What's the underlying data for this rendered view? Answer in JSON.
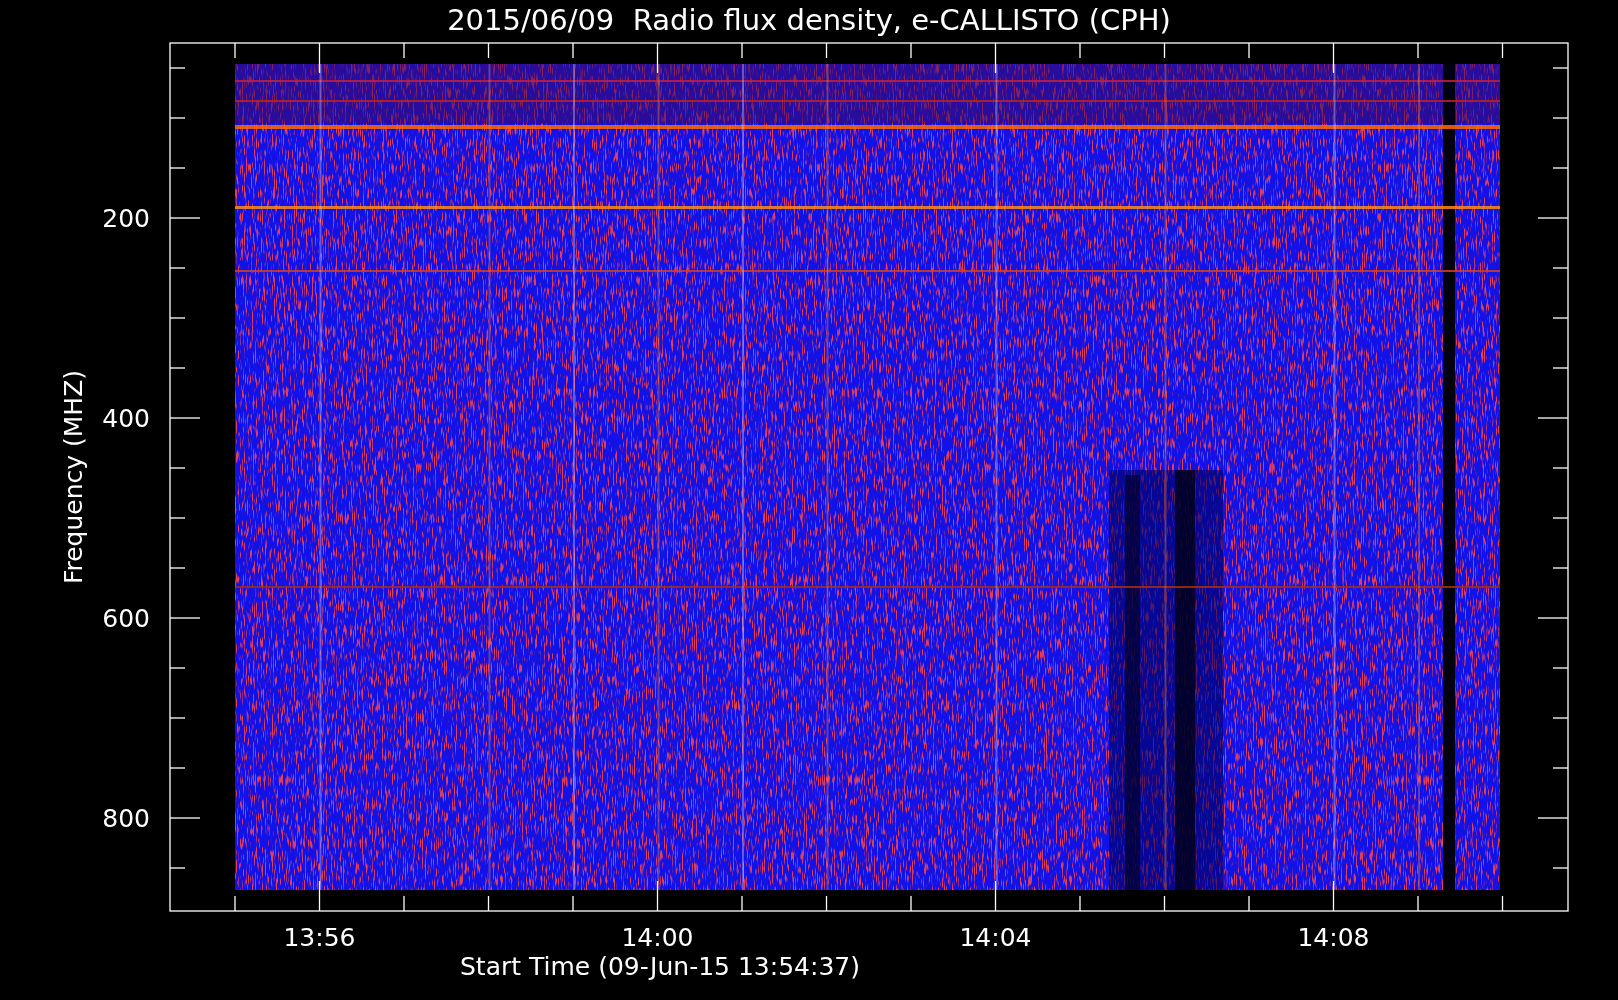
{
  "title": "2015/06/09  Radio flux density, e-CALLISTO (CPH)",
  "y_axis": {
    "label": "Frequency (MHZ)",
    "ticks": [
      "200",
      "400",
      "600",
      "800"
    ]
  },
  "x_axis": {
    "label": "Start Time (09-Jun-15 13:54:37)",
    "ticks": [
      "13:56",
      "14:00",
      "14:04",
      "14:08"
    ]
  }
}
